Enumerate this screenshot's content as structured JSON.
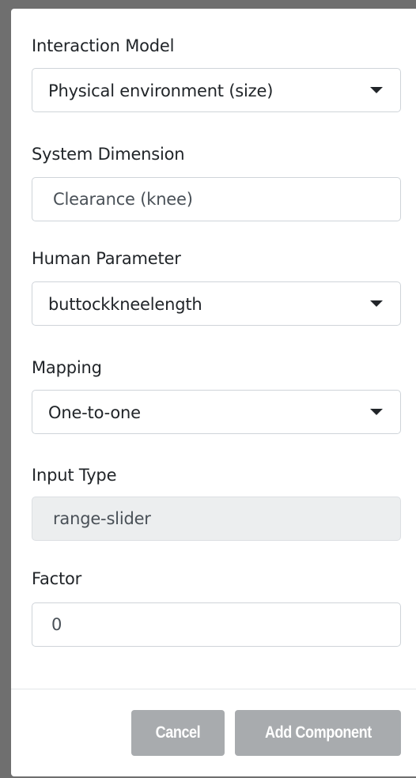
{
  "form": {
    "interaction_model": {
      "label": "Interaction Model",
      "value": "Physical environment (size)"
    },
    "system_dimension": {
      "label": "System Dimension",
      "value": "Clearance (knee)"
    },
    "human_parameter": {
      "label": "Human Parameter",
      "value": "buttockkneelength"
    },
    "mapping": {
      "label": "Mapping",
      "value": "One-to-one"
    },
    "input_type": {
      "label": "Input Type",
      "value": "range-slider"
    },
    "factor": {
      "label": "Factor",
      "value": "0"
    }
  },
  "footer": {
    "cancel_label": "Cancel",
    "add_label": "Add Component"
  },
  "colors": {
    "button_disabled": "#a8abae",
    "input_disabled_bg": "#eceeef",
    "border": "#cfd4d9",
    "text": "#212529"
  }
}
